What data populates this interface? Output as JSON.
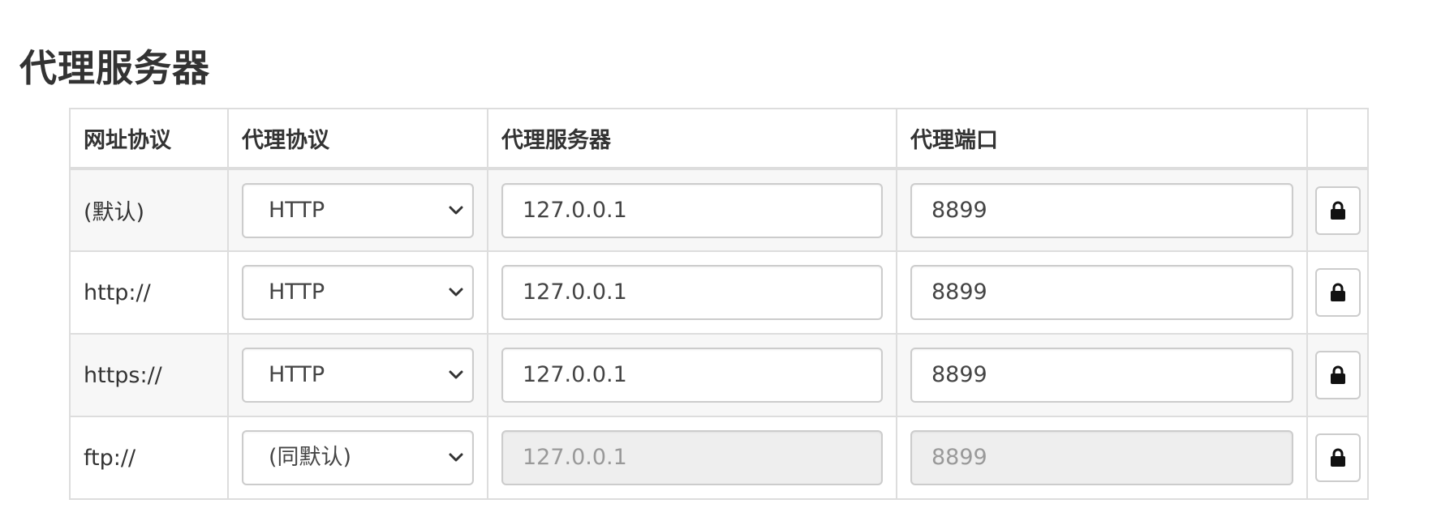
{
  "page_title": "代理服务器",
  "table": {
    "headers": {
      "scheme": "网址协议",
      "protocol": "代理协议",
      "server": "代理服务器",
      "port": "代理端口",
      "action": ""
    },
    "rows": [
      {
        "scheme": "(默认)",
        "protocol": "HTTP",
        "server": "127.0.0.1",
        "port": "8899",
        "disabled": false,
        "lock_icon": "lock-icon"
      },
      {
        "scheme": "http://",
        "protocol": "HTTP",
        "server": "127.0.0.1",
        "port": "8899",
        "disabled": false,
        "lock_icon": "lock-icon"
      },
      {
        "scheme": "https://",
        "protocol": "HTTP",
        "server": "127.0.0.1",
        "port": "8899",
        "disabled": false,
        "lock_icon": "lock-icon"
      },
      {
        "scheme": "ftp://",
        "protocol": "(同默认)",
        "server": "127.0.0.1",
        "port": "8899",
        "disabled": true,
        "lock_icon": "lock-icon"
      }
    ]
  },
  "colors": {
    "border": "#dddddd",
    "stripe": "#f7f7f7",
    "disabled_input": "#eeeeee",
    "text": "#333333"
  }
}
